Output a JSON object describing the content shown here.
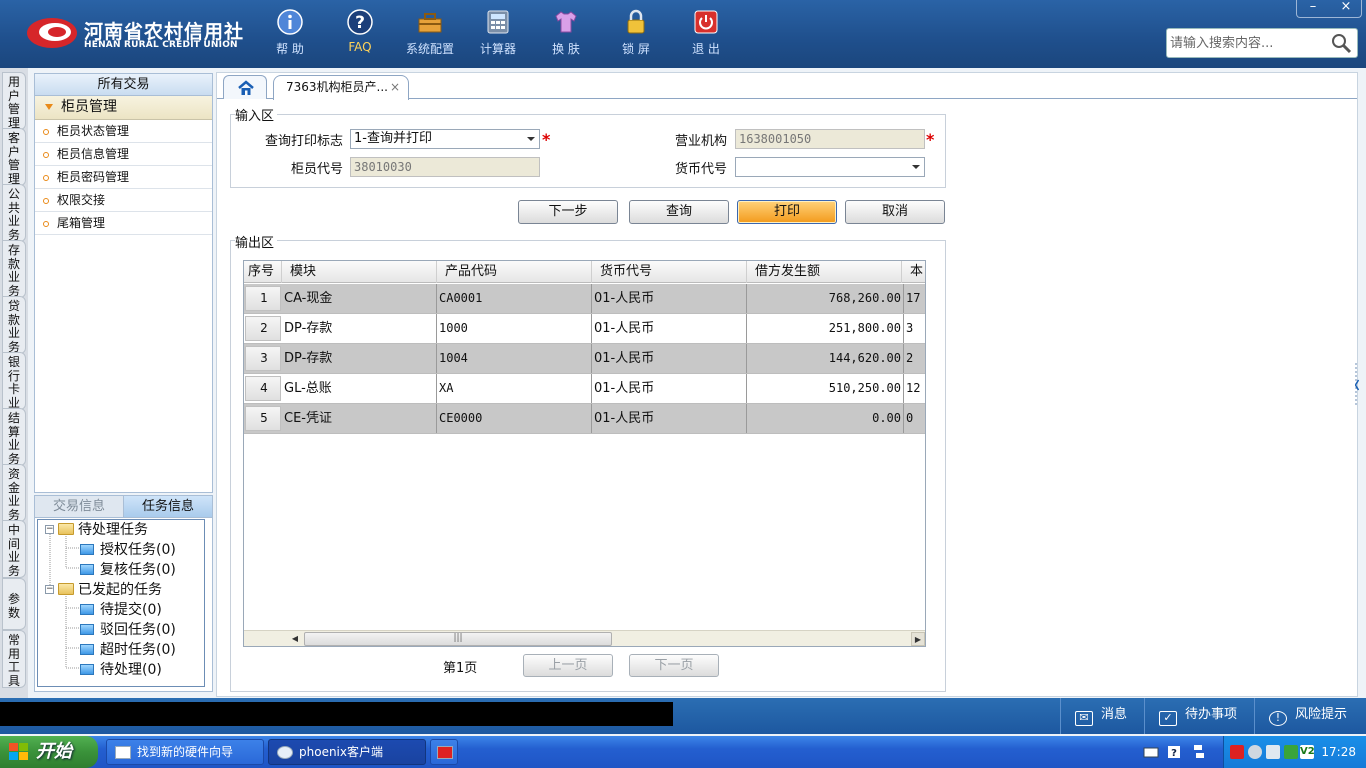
{
  "header": {
    "logo_cn": "河南省农村信用社",
    "logo_en": "HENAN RURAL CREDIT UNION",
    "toolbar": [
      {
        "label": "帮 助",
        "icon": "info-icon"
      },
      {
        "label": "FAQ",
        "icon": "help-question-icon"
      },
      {
        "label": "系统配置",
        "icon": "toolbox-icon"
      },
      {
        "label": "计算器",
        "icon": "calculator-icon"
      },
      {
        "label": "换 肤",
        "icon": "shirt-icon"
      },
      {
        "label": "锁 屏",
        "icon": "lock-icon"
      },
      {
        "label": "退 出",
        "icon": "power-icon"
      }
    ],
    "search_placeholder": "请输入搜索内容...",
    "win_min": "–",
    "win_close": "×"
  },
  "vertical_tabs": [
    "用户管理",
    "客户管理",
    "公共业务",
    "存款业务",
    "贷款业务",
    "银行卡业务",
    "结算业务",
    "资金业务",
    "中间业务",
    "参数",
    "常用工具"
  ],
  "nav": {
    "header": "所有交易",
    "group": "柜员管理",
    "items": [
      "柜员状态管理",
      "柜员信息管理",
      "柜员密码管理",
      "权限交接",
      "尾箱管理"
    ]
  },
  "task_panel": {
    "tab_trade": "交易信息",
    "tab_task": "任务信息",
    "tree": [
      {
        "label": "待处理任务",
        "children": [
          "授权任务(0)",
          "复核任务(0)"
        ]
      },
      {
        "label": "已发起的任务",
        "children": [
          "待提交(0)",
          "驳回任务(0)",
          "超时任务(0)",
          "待处理(0)"
        ]
      }
    ]
  },
  "tabs": {
    "active": "7363机构柜员产...",
    "close": "×"
  },
  "input_area": {
    "legend": "输入区",
    "print_flag_label": "查询打印标志",
    "print_flag_value": "1-查询并打印",
    "org_label": "营业机构",
    "org_value": "1638001050",
    "teller_label": "柜员代号",
    "teller_value": "38010030",
    "currency_label": "货币代号",
    "currency_value": "",
    "required_mark": "*"
  },
  "buttons": {
    "next": "下一步",
    "query": "查询",
    "print": "打印",
    "cancel": "取消"
  },
  "output_area": {
    "legend": "输出区",
    "columns": [
      "序号",
      "模块",
      "产品代码",
      "货币代号",
      "借方发生额",
      "本"
    ],
    "rows": [
      {
        "idx": "1",
        "module": "CA-现金",
        "product": "CA0001",
        "currency": "01-人民币",
        "debit": "768,260.00",
        "extra": "17"
      },
      {
        "idx": "2",
        "module": "DP-存款",
        "product": "1000",
        "currency": "01-人民币",
        "debit": "251,800.00",
        "extra": "3"
      },
      {
        "idx": "3",
        "module": "DP-存款",
        "product": "1004",
        "currency": "01-人民币",
        "debit": "144,620.00",
        "extra": "2"
      },
      {
        "idx": "4",
        "module": "GL-总账",
        "product": "XA",
        "currency": "01-人民币",
        "debit": "510,250.00",
        "extra": "12"
      },
      {
        "idx": "5",
        "module": "CE-凭证",
        "product": "CE0000",
        "currency": "01-人民币",
        "debit": "0.00",
        "extra": "0"
      }
    ],
    "page_label": "第1页",
    "prev_page": "上一页",
    "next_page": "下一页"
  },
  "statusbar": {
    "message": "消息",
    "todo": "待办事项",
    "risk": "风险提示"
  },
  "taskbar": {
    "start": "开始",
    "items": [
      "找到新的硬件向导",
      "phoenix客户端"
    ],
    "clock": "17:28"
  },
  "colors": {
    "header_blue": "#1f4f8c",
    "accent_orange": "#f39a1c",
    "required_red": "#dd0000",
    "row_shade": "#c8c8c8"
  }
}
